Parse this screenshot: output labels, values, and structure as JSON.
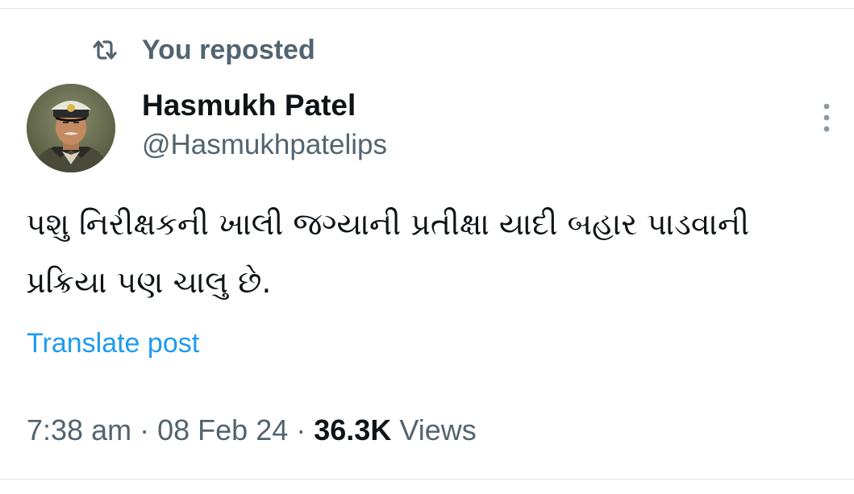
{
  "repost": {
    "icon": "repost-icon",
    "label": "You reposted"
  },
  "author": {
    "avatar_icon": "avatar-photo",
    "name": "Hasmukh Patel",
    "handle": "@Hasmukhpatelips"
  },
  "more_icon": "more-vertical-icon",
  "post": {
    "line1": "પશુ નિરીક્ષકની ખાલી જગ્યાની પ્રતીક્ષા યાદી બહાર પાડવાની",
    "line2": "પ્રક્રિયા પણ ચાલુ છે."
  },
  "translate_label": "Translate post",
  "meta": {
    "time": "7:38 am",
    "separator": "·",
    "date": "08 Feb 24",
    "views_count": "36.3K",
    "views_label": "Views"
  },
  "colors": {
    "text_primary": "#0f1419",
    "text_secondary": "#536471",
    "link": "#1d9bf0",
    "divider": "#e3e6e9"
  }
}
